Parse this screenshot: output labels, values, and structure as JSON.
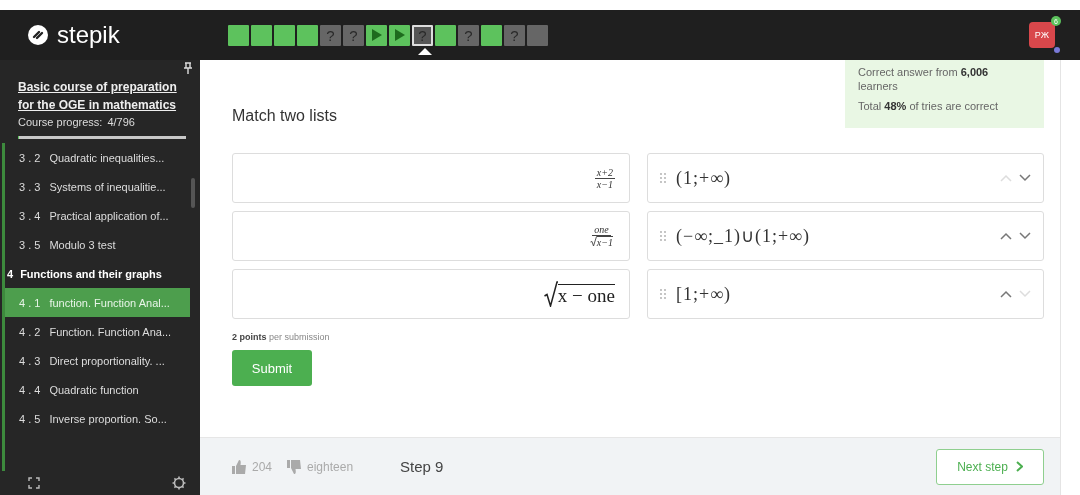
{
  "header": {
    "logo": "stepik",
    "steps": [
      {
        "kind": "done",
        "selected": false
      },
      {
        "kind": "done",
        "selected": false
      },
      {
        "kind": "done",
        "selected": false
      },
      {
        "kind": "done",
        "selected": false
      },
      {
        "kind": "quiz",
        "label": "?",
        "selected": false
      },
      {
        "kind": "quiz",
        "label": "?",
        "selected": false
      },
      {
        "kind": "video",
        "selected": false
      },
      {
        "kind": "video",
        "selected": false
      },
      {
        "kind": "quiz",
        "label": "?",
        "selected": true
      },
      {
        "kind": "done",
        "selected": false
      },
      {
        "kind": "quiz",
        "label": "?",
        "selected": false
      },
      {
        "kind": "done",
        "selected": false
      },
      {
        "kind": "quiz",
        "label": "?",
        "selected": false
      },
      {
        "kind": "locked",
        "selected": false
      }
    ],
    "avatar": {
      "initials": "PЖ",
      "badge": "6"
    }
  },
  "sidebar": {
    "course_title": "Basic course of preparation for the OGE in mathematics",
    "progress_label": "Course progress:",
    "progress_value": "4/796",
    "progress": {
      "level": 0.005
    },
    "items": [
      {
        "kind": "lesson",
        "number": "3 . 2",
        "title": "Quadratic inequalities...",
        "selected": false
      },
      {
        "kind": "lesson",
        "number": "3 . 3",
        "title": "Systems of inequalitie...",
        "selected": false
      },
      {
        "kind": "lesson",
        "number": "3 . 4",
        "title": "Practical application of...",
        "selected": false
      },
      {
        "kind": "lesson",
        "number": "3 . 5",
        "title": "Modulo 3 test",
        "selected": false
      },
      {
        "kind": "section",
        "number": "4",
        "title": "Functions and their graphs",
        "selected": false
      },
      {
        "kind": "lesson",
        "number": "4 . 1",
        "title": "function. Function Anal...",
        "selected": true
      },
      {
        "kind": "lesson",
        "number": "4 . 2",
        "title": "Function. Function Ana...",
        "selected": false
      },
      {
        "kind": "lesson",
        "number": "4 . 3",
        "title": "Direct proportionality. ...",
        "selected": false
      },
      {
        "kind": "lesson",
        "number": "4 . 4",
        "title": "Quadratic function",
        "selected": false
      },
      {
        "kind": "lesson",
        "number": "4 . 5",
        "title": "Inverse proportion. So...",
        "selected": false
      }
    ]
  },
  "stats": {
    "correct": "Correct answer from **6,006** learners",
    "tries": "Total **48%** of tries are correct"
  },
  "task": {
    "title": "Match two lists",
    "pairs": [
      {
        "left": {
          "kind": "fraction",
          "num": "x+2",
          "den": "x−1"
        },
        "right": "(1;+∞)",
        "up_disabled": true,
        "down_disabled": false
      },
      {
        "left": {
          "kind": "fraction_root",
          "num": "one",
          "den": "x−1"
        },
        "right": "(−∞;_1)∪(1;+∞)",
        "up_disabled": false,
        "down_disabled": false
      },
      {
        "left": {
          "kind": "root",
          "body": "x − one"
        },
        "right": "[1;+∞)",
        "up_disabled": false,
        "down_disabled": true
      }
    ],
    "points": "**2 points** per submission",
    "submit": "Submit"
  },
  "footer": {
    "likes": "204",
    "dislikes": "eighteen",
    "step": "Step 9",
    "next": "Next step"
  }
}
